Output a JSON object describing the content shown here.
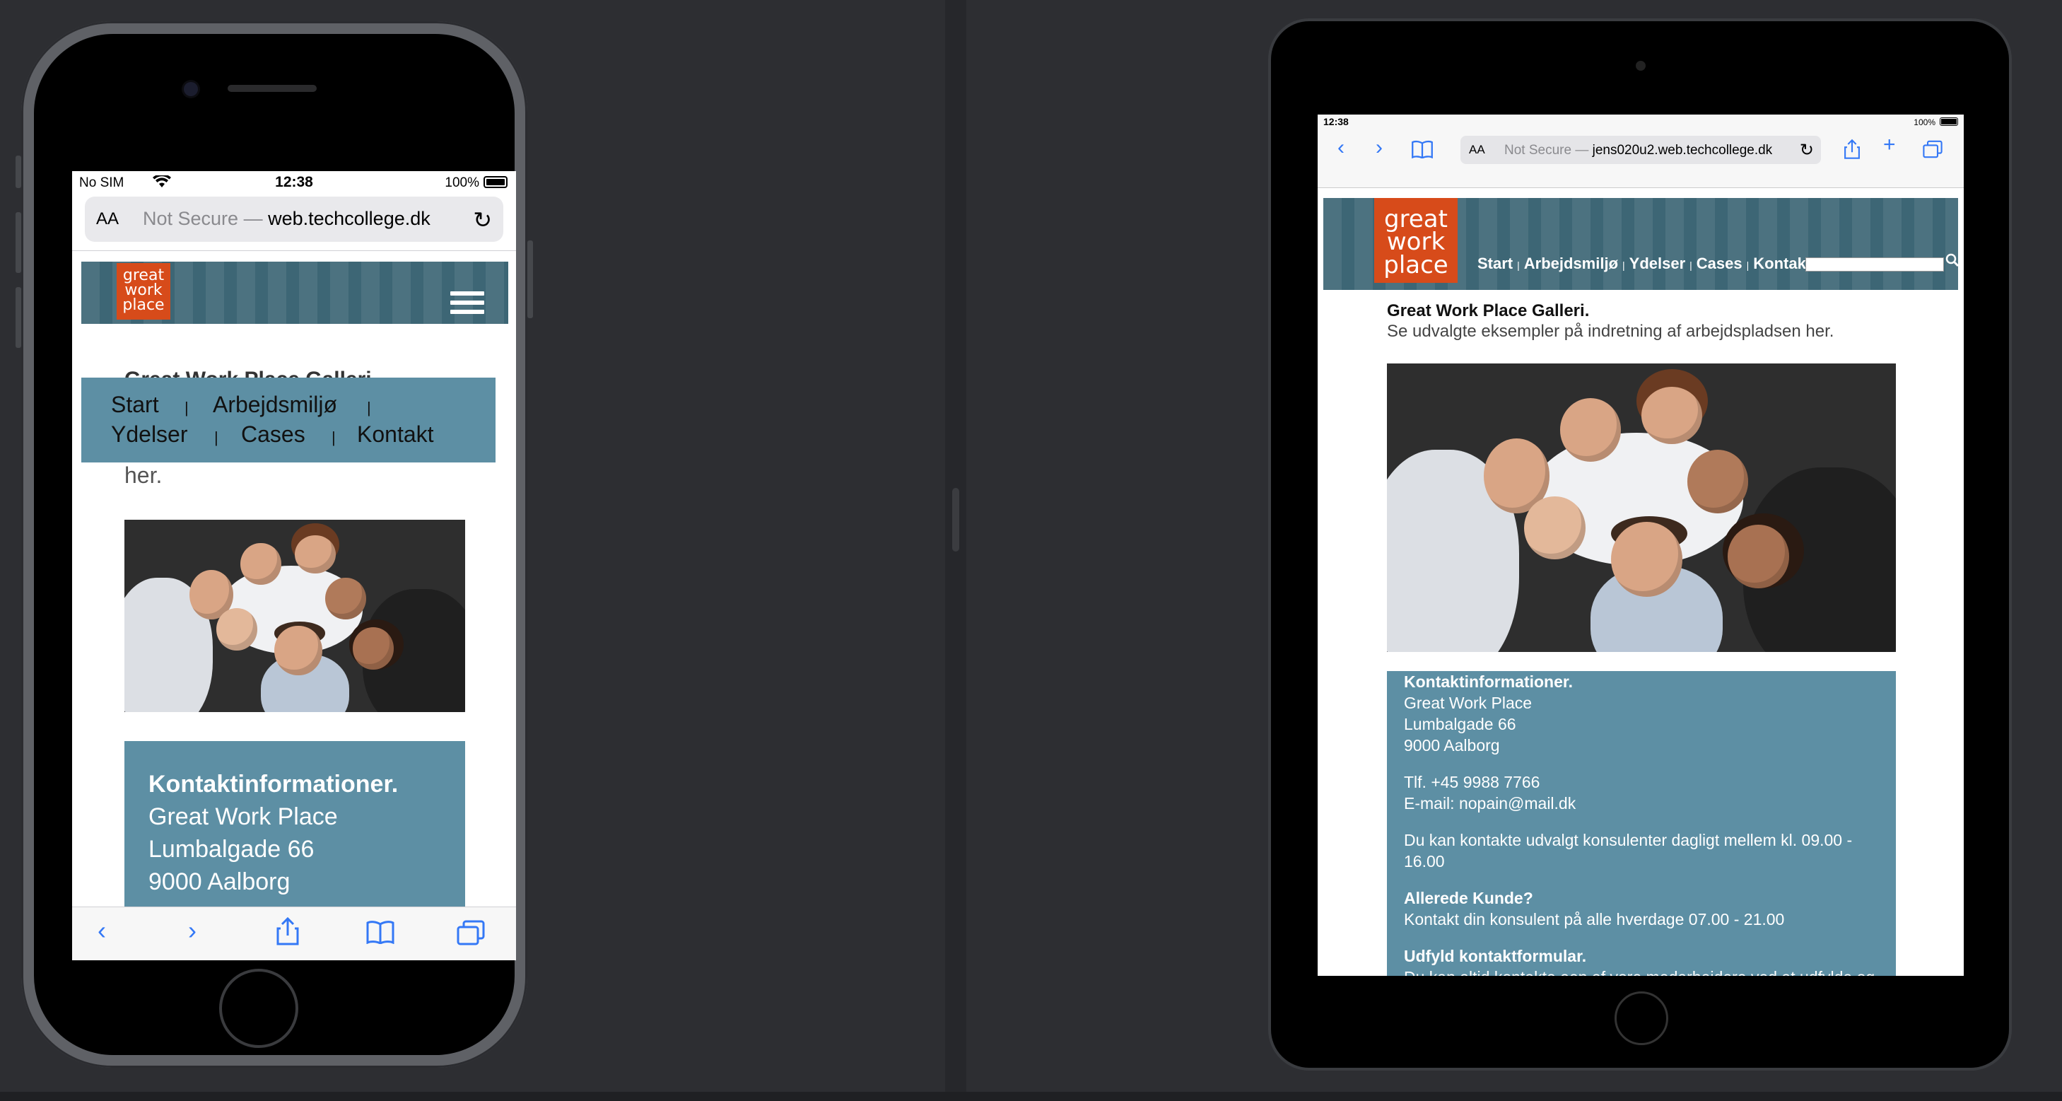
{
  "phone": {
    "status": {
      "carrier": "No SIM",
      "time": "12:38",
      "battery": "100%"
    },
    "url_bar": {
      "text_size_label": "AA",
      "not_secure": "Not Secure —",
      "host": "web.techcollege.dk"
    },
    "logo": {
      "line1": "great",
      "line2": "work",
      "line3": "place"
    },
    "menu": {
      "items": [
        "Start",
        "Arbejdsmiljø",
        "Ydelser",
        "Cases",
        "Kontakt"
      ],
      "separator": "|"
    },
    "hidden_title": "Great Work Place Galleri.",
    "subtitle_tail": "her.",
    "contact": {
      "heading": "Kontaktinformationer.",
      "lines": [
        "Great Work Place",
        "Lumbalgade 66",
        "9000 Aalborg"
      ]
    }
  },
  "tablet": {
    "status": {
      "time": "12:38",
      "battery": "100%"
    },
    "url_bar": {
      "text_size_label": "AA",
      "not_secure": "Not Secure —",
      "host": "jens020u2.web.techcollege.dk"
    },
    "logo": {
      "line1": "great",
      "line2": "work",
      "line3": "place"
    },
    "nav": {
      "items": [
        "Start",
        "Arbejdsmiljø",
        "Ydelser",
        "Cases",
        "Kontakt"
      ],
      "separator": "|"
    },
    "title": "Great Work Place Galleri.",
    "subtitle": "Se udvalgte eksempler på indretning af arbejdspladsen her.",
    "contact": {
      "heading": "Kontaktinformationer.",
      "address": [
        "Great Work Place",
        "Lumbalgade 66",
        "9000 Aalborg"
      ],
      "phone": "Tlf. +45 9988 7766",
      "email": "E-mail: nopain@mail.dk",
      "hours_text": "Du kan kontakte udvalgt konsulenter dagligt mellem kl. 09.00 - 16.00",
      "customer_heading": "Allerede Kunde?",
      "customer_text": "Kontakt din konsulent på alle hverdage 07.00 - 21.00",
      "form_heading": "Udfyld kontaktformular.",
      "form_text": "Du kan altid kontakte een af vore medarbejdere ved at udfylde og"
    }
  },
  "icons": {
    "back": "chevron-left-icon",
    "forward": "chevron-right-icon",
    "share": "share-icon",
    "bookmarks": "book-icon",
    "tabs": "tabs-icon",
    "reload": "reload-icon",
    "wifi": "wifi-icon",
    "search": "magnifier-icon",
    "menu": "hamburger-icon"
  },
  "colors": {
    "banner": "#3d6675",
    "logo": "#d74b1a",
    "menu": "#5d8fa4",
    "link": "#3478f6"
  }
}
